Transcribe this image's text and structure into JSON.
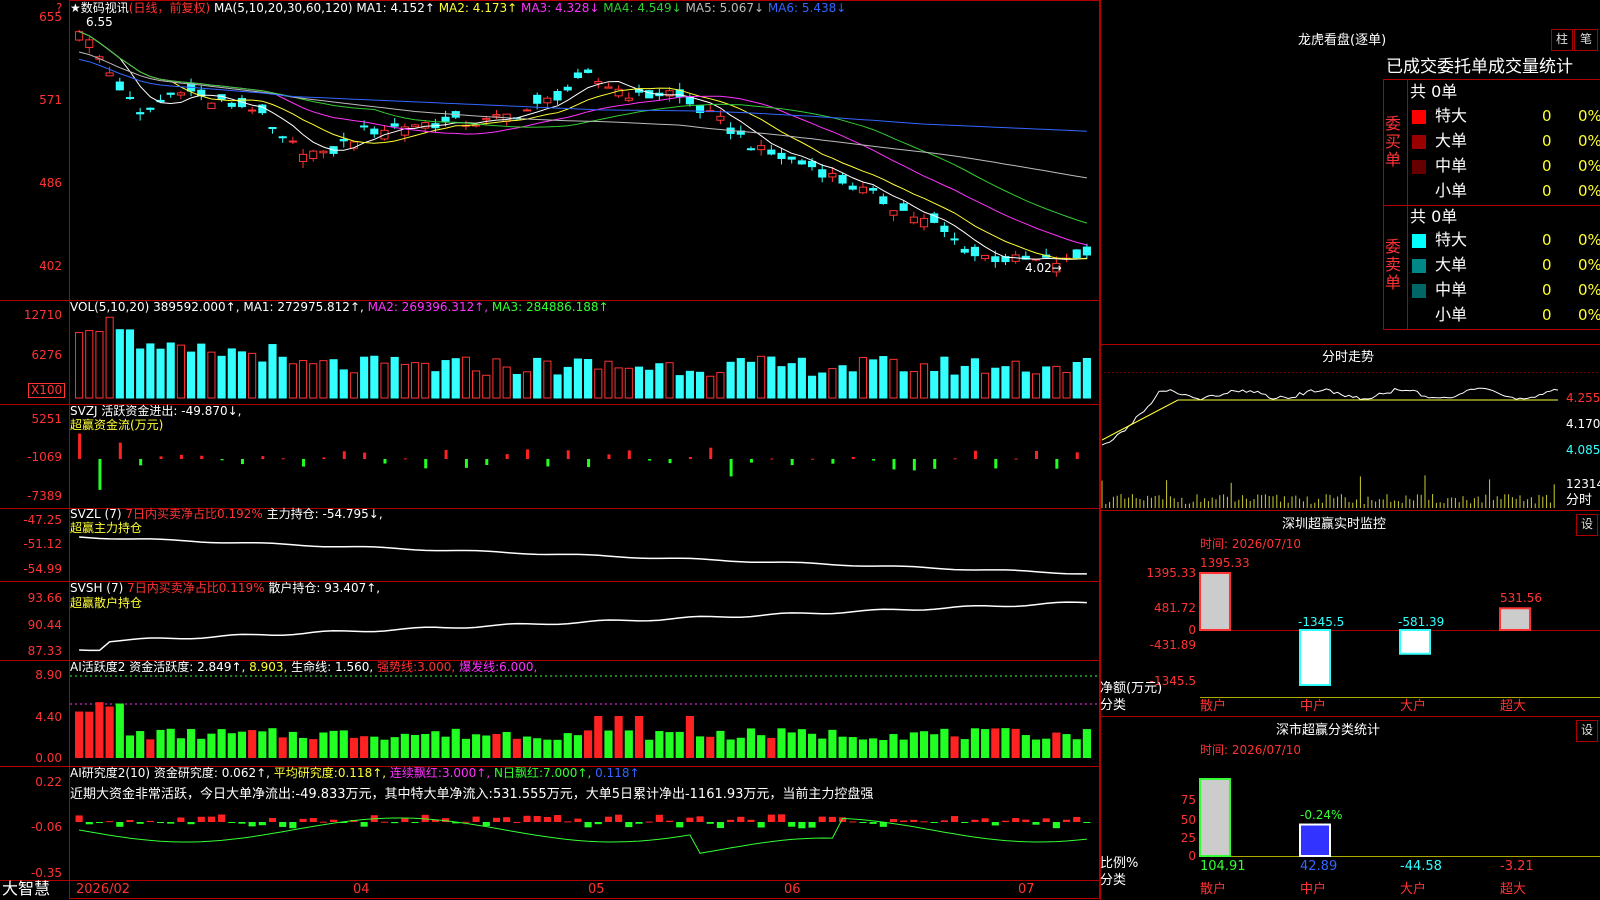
{
  "app": {
    "brand": "大智慧",
    "window_title": "★数码视讯",
    "period": "(日线，前复权)"
  },
  "top_marker": "?",
  "price_panel": {
    "ma_title": "MA(5,10,20,30,60,120)",
    "ma": [
      {
        "name": "MA1:",
        "value": "4.152↑",
        "color": "#ffffff"
      },
      {
        "name": "MA2:",
        "value": "4.173↑",
        "color": "#ffff33"
      },
      {
        "name": "MA3:",
        "value": "4.328↓",
        "color": "#ff33ff"
      },
      {
        "name": "MA4:",
        "value": "4.549↓",
        "color": "#33cc33"
      },
      {
        "name": "MA5:",
        "value": "5.067↓",
        "color": "#bbbbbb"
      },
      {
        "name": "MA6:",
        "value": "5.438↓",
        "color": "#3366ff"
      }
    ],
    "y_ticks": [
      "655",
      "571",
      "486",
      "402"
    ],
    "high_label": "6.55",
    "low_label": "4.02→"
  },
  "vol_panel": {
    "title": "VOL(5,10,20)",
    "value": "389592.000↑,",
    "ma": [
      {
        "name": "MA1:",
        "value": "272975.812↑,",
        "color": "#ffffff"
      },
      {
        "name": "MA2:",
        "value": "269396.312↑,",
        "color": "#ff33ff"
      },
      {
        "name": "MA3:",
        "value": "284886.188↑",
        "color": "#33ff33"
      }
    ],
    "y_ticks": [
      "12710",
      "6276"
    ],
    "unit": "X100"
  },
  "svzj_panel": {
    "title": "SVZJ",
    "label": "活跃资金进出:",
    "value": "-49.870↓,",
    "subtitle": "超赢资金流(万元)",
    "y_ticks": [
      "5251",
      "-1069",
      "-7389"
    ]
  },
  "svzl_panel": {
    "title": "SVZL (7)",
    "ratio_label": "7日内买卖净占比0.192%",
    "label": "主力持仓:",
    "value": "-54.795↓,",
    "subtitle": "超赢主力持仓",
    "y_ticks": [
      "-47.25",
      "-51.12",
      "-54.99"
    ]
  },
  "svsh_panel": {
    "title": "SVSH (7)",
    "ratio_label": "7日内买卖净占比0.119%",
    "label": "散户持仓:",
    "value": "93.407↑,",
    "subtitle": "超赢散户持仓",
    "y_ticks": [
      "93.66",
      "90.44",
      "87.33"
    ]
  },
  "ai_act_panel": {
    "title": "AI活跃度2",
    "label": "资金活跃度:",
    "value": "2.849↑,",
    "value2": "8.903,",
    "life_label": "生命线:",
    "life_value": "1.560,",
    "strong_label": "强势线:",
    "strong_value": "3.000,",
    "burst_label": "爆发线:",
    "burst_value": "6.000,",
    "y_ticks": [
      "8.90",
      "4.40",
      "0.00"
    ]
  },
  "ai_res_panel": {
    "title": "AI研究度2(10)",
    "label": "资金研究度:",
    "value": "0.062↑,",
    "avg_label": "平均研究度:",
    "avg_value": "0.118↑,",
    "cont_label": "连续飘红:",
    "cont_value": "3.000↑,",
    "n_label": "N日飘红:",
    "n_value": "7.000↑,",
    "last": "0.118↑",
    "summary": "近期大资金非常活跃，今日大单净流出:-49.833万元，其中特大单净流入:531.555万元，大单5日累计净出-1161.93万元，当前主力控盘强",
    "y_ticks": [
      "0.22",
      "-0.06",
      "-0.35"
    ]
  },
  "x_axis": [
    "2026/02",
    "04",
    "05",
    "06",
    "07"
  ],
  "right": {
    "dragon_title": "龙虎看盘(逐单)",
    "btn_zhu": "柱",
    "btn_bi": "笔",
    "deal_title": "已成交委托单成交量统计",
    "buy": {
      "side": "委买单",
      "total": "共 0单",
      "rows": [
        {
          "name": "特大",
          "color": "#ff0000",
          "count": "0",
          "pct": "0%"
        },
        {
          "name": "大单",
          "color": "#990000",
          "count": "0",
          "pct": "0%"
        },
        {
          "name": "中单",
          "color": "#660000",
          "count": "0",
          "pct": "0%"
        },
        {
          "name": "小单",
          "color": "",
          "count": "0",
          "pct": "0%"
        }
      ]
    },
    "sell": {
      "side": "委卖单",
      "total": "共 0单",
      "rows": [
        {
          "name": "特大",
          "color": "#00ffff",
          "count": "0",
          "pct": "0%"
        },
        {
          "name": "大单",
          "color": "#008888",
          "count": "0",
          "pct": "0%"
        },
        {
          "name": "中单",
          "color": "#006666",
          "count": "0",
          "pct": "0%"
        },
        {
          "name": "小单",
          "color": "",
          "count": "0",
          "pct": "0%"
        }
      ]
    },
    "intraday_title": "分时走势",
    "intraday_ticks": [
      "4.255",
      "4.170",
      "4.085"
    ],
    "intraday_vol": "12314",
    "intraday_label": "分时",
    "sz_monitor": {
      "title": "深圳超赢实时监控",
      "set": "设",
      "time_label": "时间: 2026/07/10",
      "y_ticks": [
        "1395.33",
        "481.72",
        "0",
        "-431.89",
        "-1345.5"
      ],
      "axis_label1": "净额(万元)",
      "axis_label2": "分类",
      "categories": [
        "散户",
        "中户",
        "大户",
        "超大"
      ],
      "values": [
        1395.33,
        -1345.5,
        -581.39,
        531.56
      ],
      "value_labels": [
        "1395.33",
        "-1345.5",
        "-581.39",
        "531.56"
      ]
    },
    "sz_class": {
      "title": "深市超赢分类统计",
      "set": "设",
      "time_label": "时间: 2026/07/10",
      "y_ticks": [
        "75",
        "50",
        "25",
        "0"
      ],
      "axis_label1": "比例%",
      "axis_label2": "分类",
      "categories": [
        "散户",
        "中户",
        "大户",
        "超大"
      ],
      "values": [
        104.91,
        42.89,
        -44.58,
        -3.21
      ],
      "value_labels": [
        "104.91",
        "42.89",
        "-44.58",
        "-3.21"
      ],
      "annotation": "-0.24%"
    }
  },
  "chart_data": [
    {
      "type": "candlestick",
      "title": "数码视讯 (日线，前复权)",
      "ylim": [
        4.0,
        6.55
      ],
      "x_ticks": [
        "2026/02",
        "04",
        "05",
        "06",
        "07"
      ],
      "anchors": [
        [
          0,
          6.45
        ],
        [
          6,
          5.55
        ],
        [
          10,
          5.85
        ],
        [
          13,
          5.7
        ],
        [
          17,
          5.65
        ],
        [
          20,
          5.3
        ],
        [
          24,
          5.15
        ],
        [
          28,
          5.4
        ],
        [
          33,
          5.48
        ],
        [
          40,
          5.5
        ],
        [
          45,
          5.65
        ],
        [
          50,
          5.95
        ],
        [
          55,
          5.75
        ],
        [
          58,
          5.8
        ],
        [
          63,
          5.5
        ],
        [
          67,
          5.2
        ],
        [
          72,
          5.05
        ],
        [
          78,
          4.75
        ],
        [
          84,
          4.45
        ],
        [
          88,
          4.15
        ],
        [
          92,
          4.1
        ],
        [
          97,
          4.08
        ],
        [
          99,
          4.18
        ]
      ],
      "n": 100,
      "ma": [
        {
          "name": "MA1",
          "color": "#ffffff",
          "period": 5
        },
        {
          "name": "MA2",
          "color": "#ffff33",
          "period": 10
        },
        {
          "name": "MA3",
          "color": "#ff33ff",
          "period": 20
        },
        {
          "name": "MA4",
          "color": "#33cc33",
          "period": 30
        },
        {
          "name": "MA5",
          "color": "#bbbbbb",
          "period": 60
        },
        {
          "name": "MA6",
          "color": "#3366ff",
          "period": 120
        }
      ]
    },
    {
      "type": "bar",
      "name": "VOL",
      "ylim": [
        0,
        12710
      ],
      "max_value": 12710
    },
    {
      "type": "bar",
      "name": "SVZJ",
      "ylim": [
        -7389,
        5251
      ]
    },
    {
      "type": "line",
      "name": "SVZL",
      "ylim": [
        -54.99,
        -47.25
      ]
    },
    {
      "type": "line",
      "name": "SVSH",
      "ylim": [
        87.33,
        93.66
      ]
    },
    {
      "type": "bar",
      "name": "AI活跃度2",
      "ylim": [
        0,
        8.9
      ]
    },
    {
      "type": "bar",
      "name": "AI研究度2",
      "ylim": [
        -0.35,
        0.22
      ]
    }
  ]
}
